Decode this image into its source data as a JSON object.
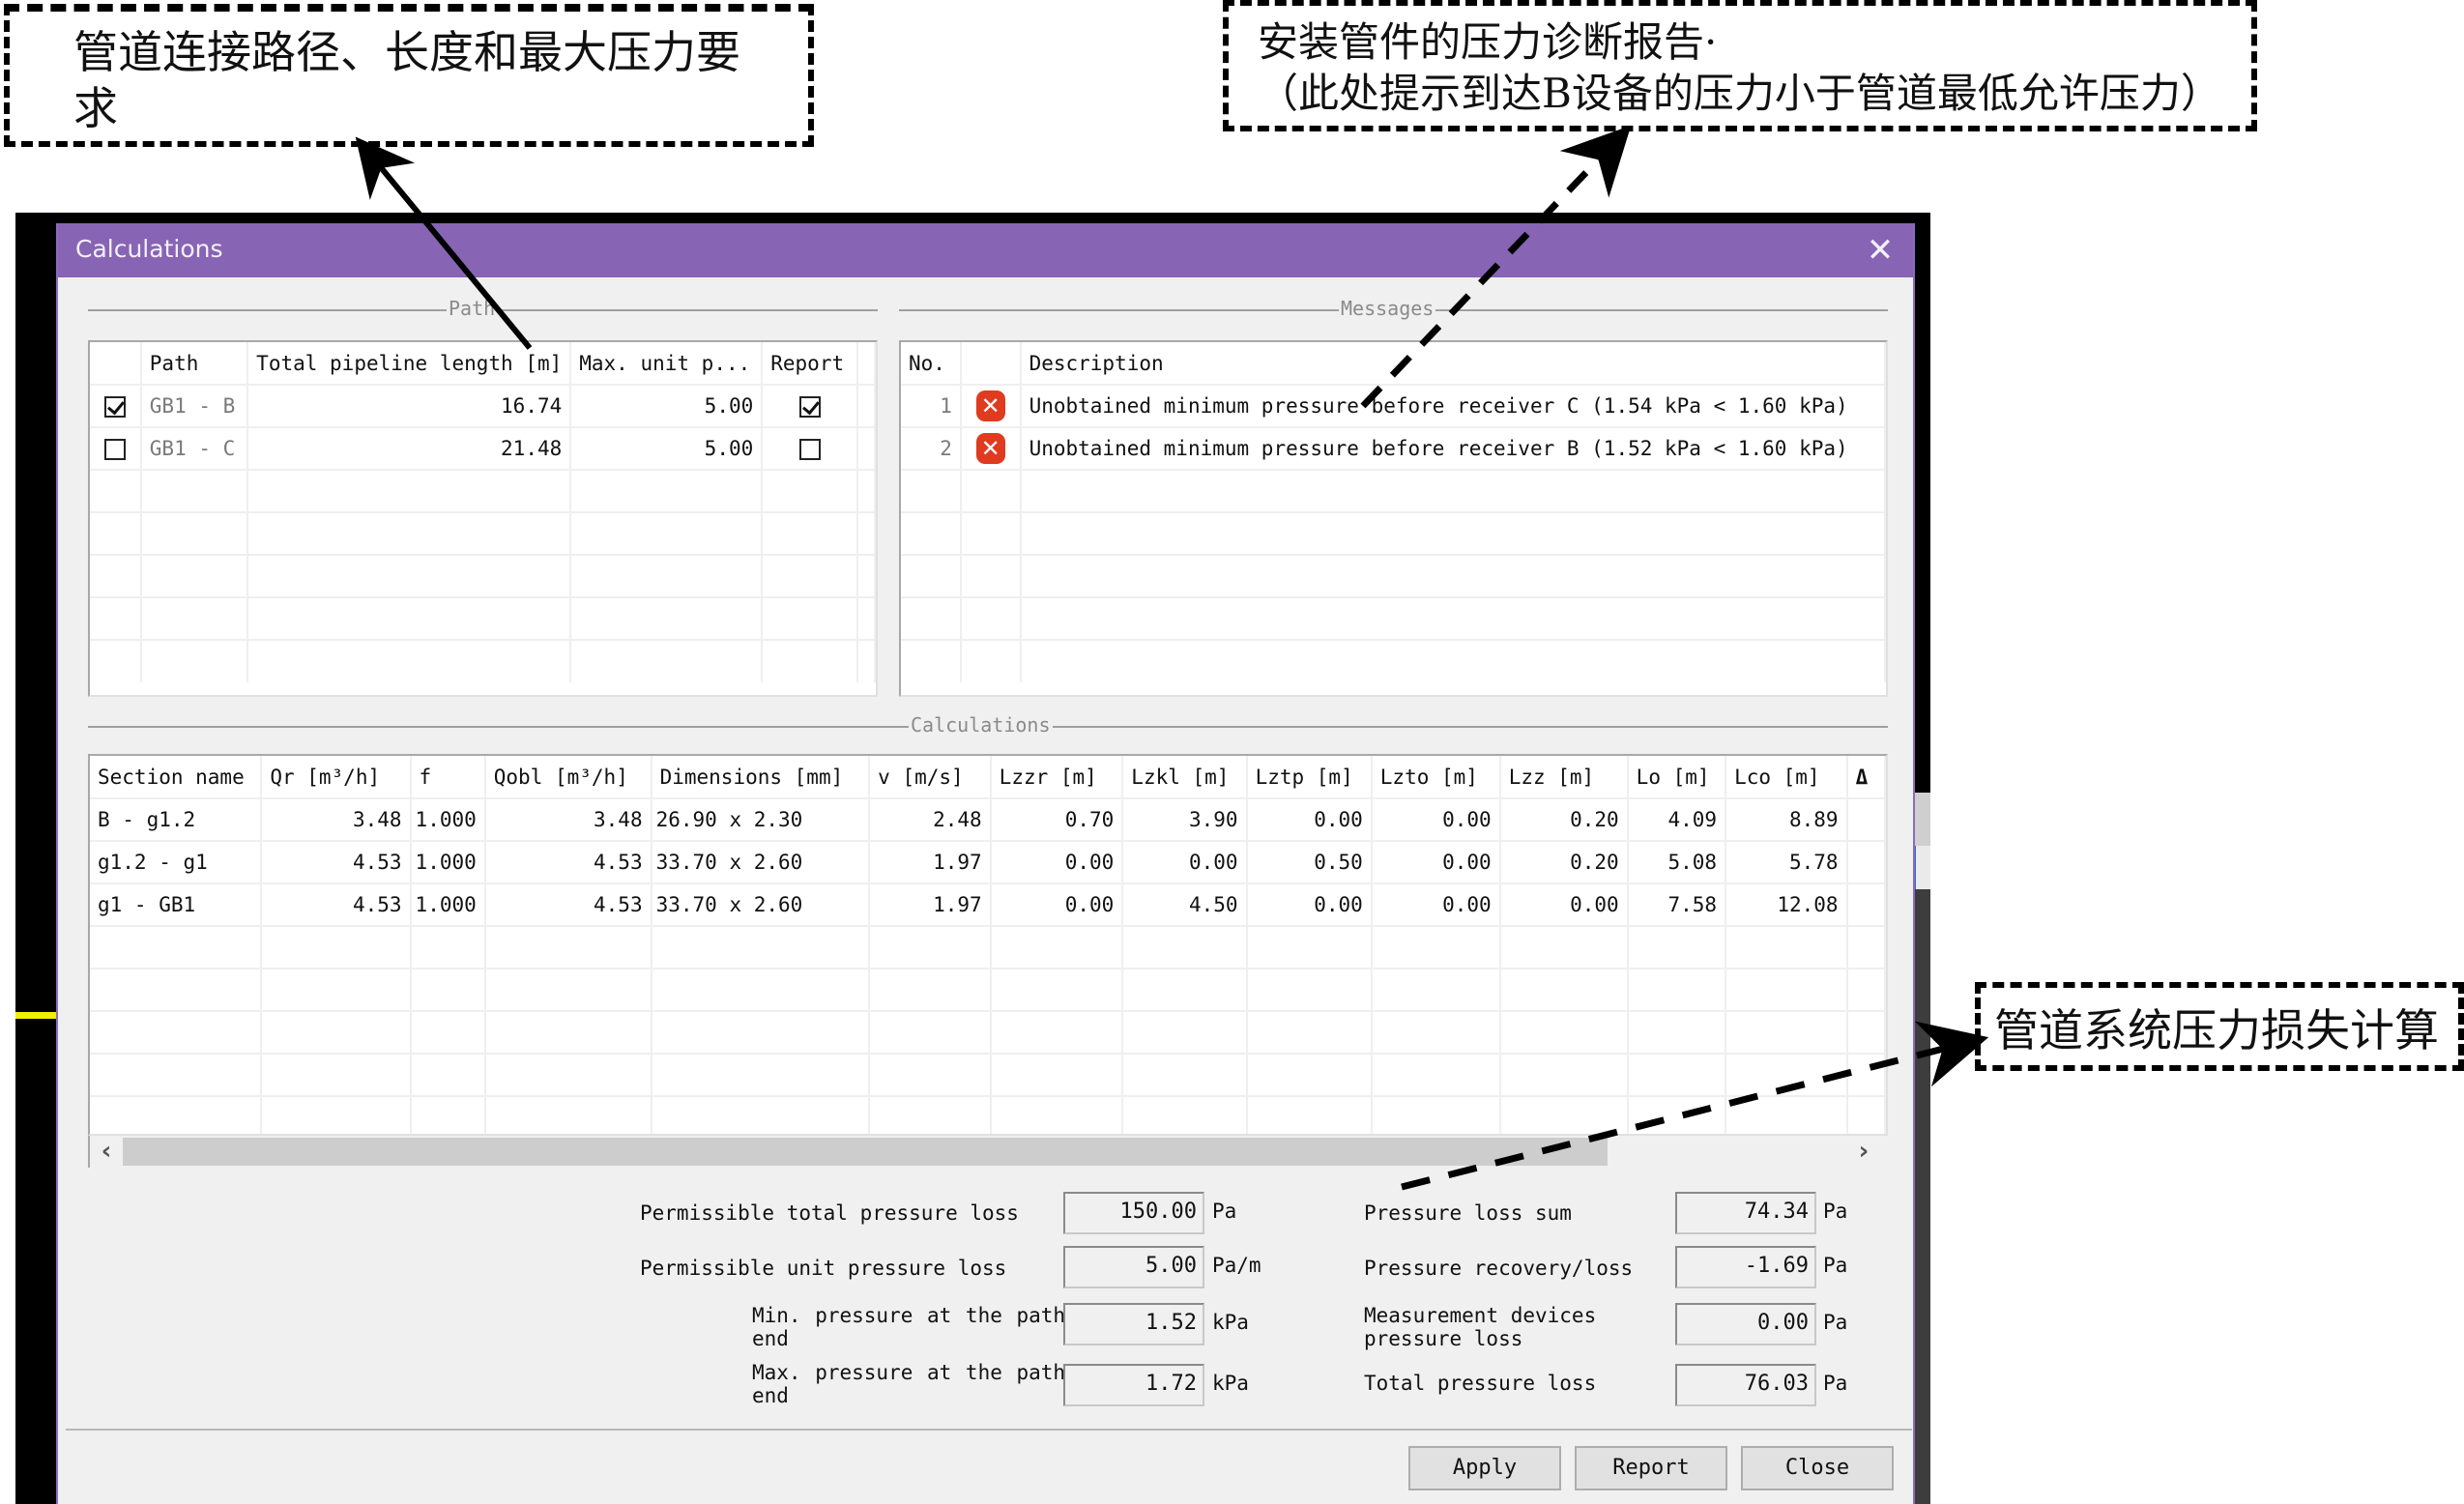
{
  "annotations": {
    "path_callout": "管道连接路径、长度和最大压力要求",
    "messages_callout_line1": "安装管件的压力诊断报告·",
    "messages_callout_line2": "（此处提示到达B设备的压力小于管道最低允许压力）",
    "calc_callout": "管道系统压力损失计算"
  },
  "dialog": {
    "title": "Calculations",
    "close_icon": "close-icon",
    "accent_color": "#8764b4"
  },
  "path_group": {
    "label": "Path",
    "columns": [
      "",
      "Path",
      "Total pipeline length [m]",
      "Max. unit p...",
      "Report"
    ],
    "rows": [
      {
        "selected": true,
        "path": "GB1 - B",
        "length": "16.74",
        "max_unit_p": "5.00",
        "report": true
      },
      {
        "selected": false,
        "path": "GB1 - C",
        "length": "21.48",
        "max_unit_p": "5.00",
        "report": false
      }
    ]
  },
  "messages_group": {
    "label": "Messages",
    "columns": [
      "No.",
      "",
      "Description"
    ],
    "rows": [
      {
        "no": "1",
        "icon": "error-icon",
        "description": "Unobtained minimum pressure before receiver C (1.54 kPa < 1.60 kPa)"
      },
      {
        "no": "2",
        "icon": "error-icon",
        "description": "Unobtained minimum pressure before receiver B (1.52 kPa < 1.60 kPa)"
      }
    ]
  },
  "calculations_group": {
    "label": "Calculations",
    "columns": [
      "Section name",
      "Qr [m³/h]",
      "f",
      "Qobl [m³/h]",
      "Dimensions [mm]",
      "v [m/s]",
      "Lzzr [m]",
      "Lzkl [m]",
      "Lztp [m]",
      "Lzto [m]",
      "Lzz [m]",
      "Lo [m]",
      "Lco [m]",
      "Δ"
    ],
    "rows": [
      [
        "B - g1.2",
        "3.48",
        "1.000",
        "3.48",
        "26.90 x 2.30",
        "2.48",
        "0.70",
        "3.90",
        "0.00",
        "0.00",
        "0.20",
        "4.09",
        "8.89",
        ""
      ],
      [
        "g1.2 - g1",
        "4.53",
        "1.000",
        "4.53",
        "33.70 x 2.60",
        "1.97",
        "0.00",
        "0.00",
        "0.50",
        "0.00",
        "0.20",
        "5.08",
        "5.78",
        ""
      ],
      [
        "g1 - GB1",
        "4.53",
        "1.000",
        "4.53",
        "33.70 x 2.60",
        "1.97",
        "0.00",
        "4.50",
        "0.00",
        "0.00",
        "0.00",
        "7.58",
        "12.08",
        ""
      ]
    ],
    "scroll_left": "‹",
    "scroll_right": "›"
  },
  "form_left": [
    {
      "label": "Permissible total pressure loss",
      "value": "150.00",
      "unit": "Pa"
    },
    {
      "label": "Permissible unit pressure loss",
      "value": "5.00",
      "unit": "Pa/m"
    },
    {
      "label": "Min. pressure at the path end",
      "value": "1.52",
      "unit": "kPa"
    },
    {
      "label": "Max. pressure at the path end",
      "value": "1.72",
      "unit": "kPa"
    }
  ],
  "form_right": [
    {
      "label": "Pressure loss sum",
      "value": "74.34",
      "unit": "Pa"
    },
    {
      "label": "Pressure recovery/loss",
      "value": "-1.69",
      "unit": "Pa"
    },
    {
      "label": "Measurement devices pressure loss",
      "value": "0.00",
      "unit": "Pa"
    },
    {
      "label": "Total pressure loss",
      "value": "76.03",
      "unit": "Pa"
    }
  ],
  "buttons": {
    "apply": "Apply",
    "report": "Report",
    "close": "Close"
  }
}
